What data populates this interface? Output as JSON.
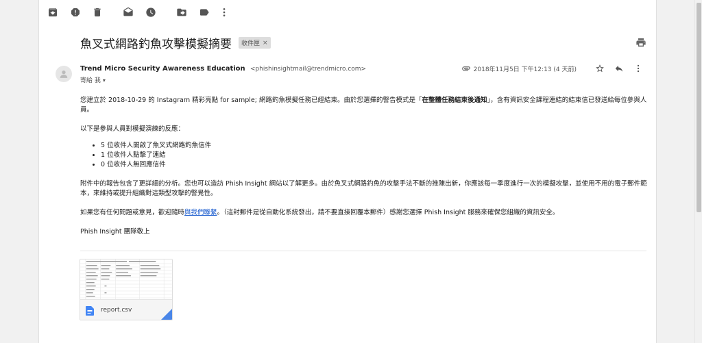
{
  "toolbar": {
    "icons": [
      "archive-icon",
      "report-spam-icon",
      "delete-icon",
      "mark-unread-icon",
      "snooze-icon",
      "move-to-icon",
      "labels-icon",
      "more-icon"
    ]
  },
  "subject": "魚叉式網路釣魚攻擊模擬摘要",
  "label": "收件匣",
  "label_close": "×",
  "sender": {
    "name": "Trend Micro Security Awareness Education",
    "email": "<phishinsightmail@trendmicro.com>",
    "to": "寄給 我",
    "to_chevron": "▾"
  },
  "date": "2018年11月5日 下午12:13 (4 天前)",
  "body": {
    "para1_a": "您建立於 2018-10-29 的 Instagram 精彩亮點 for sample; 網路釣魚模擬任務已經結束。由於您選擇的警告模式是「",
    "para1_bold": "在整體任務結束後通知",
    "para1_b": "」，含有資訊安全課程連結的結束信已發送給每位參與人員。",
    "para2": "以下是參與人員對模擬演練的反應：",
    "items": [
      "5 位收件人開啟了魚叉式網路釣魚信件",
      "1 位收件人點擊了連結",
      "0 位收件人無回應信件"
    ],
    "para3": "附件中的報告包含了更詳細的分析。您也可以造訪 Phish Insight 網站以了解更多。由於魚叉式網路釣魚的攻擊手法不斷的推陳出新，你應該每一季度進行一次的模擬攻擊，並使用不用的電子郵件範本，來維持或提升組織對這類型攻擊的警覺性。",
    "para4_a": "如果您有任何問題或意見，歡迎隨時",
    "para4_link": "與我們聯繫",
    "para4_b": "。（這封郵件是從自動化系統發出，請不要直接回覆本郵件）感謝您選擇 Phish Insight 服務來確保您組織的資訊安全。",
    "signoff": "Phish Insight 團隊敬上"
  },
  "attachment": {
    "filename": "report.csv",
    "icon": "google-sheets-icon"
  }
}
